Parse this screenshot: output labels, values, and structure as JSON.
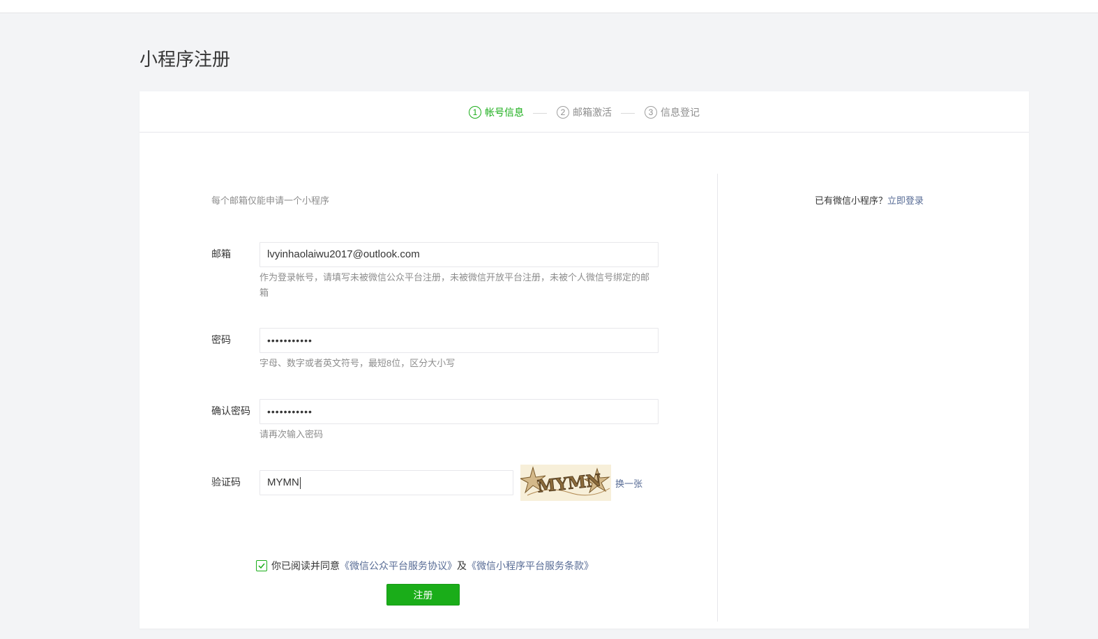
{
  "page": {
    "title": "小程序注册"
  },
  "steps": [
    {
      "num": "1",
      "label": "帐号信息",
      "active": true
    },
    {
      "num": "2",
      "label": "邮箱激活",
      "active": false
    },
    {
      "num": "3",
      "label": "信息登记",
      "active": false
    }
  ],
  "form": {
    "tip": "每个邮箱仅能申请一个小程序",
    "email": {
      "label": "邮箱",
      "value": "lvyinhaolaiwu2017@outlook.com",
      "hint": "作为登录帐号，请填写未被微信公众平台注册，未被微信开放平台注册，未被个人微信号绑定的邮箱"
    },
    "password": {
      "label": "密码",
      "value": "•••••••••••",
      "hint": "字母、数字或者英文符号，最短8位，区分大小写"
    },
    "confirm_password": {
      "label": "确认密码",
      "value": "•••••••••••",
      "hint": "请再次输入密码"
    },
    "captcha": {
      "label": "验证码",
      "value": "MYMN",
      "image_text": "MYMN",
      "swap_label": "换一张"
    },
    "agreement": {
      "checked": true,
      "prefix": "你已阅读并同意",
      "link1": "《微信公众平台服务协议》",
      "conj": "及",
      "link2": "《微信小程序平台服务条款》"
    },
    "submit_label": "注册"
  },
  "side": {
    "text": "已有微信小程序？",
    "login_link": "立即登录"
  },
  "colors": {
    "accent": "#1aad19",
    "link": "#576b95",
    "hint": "#8d8d8d"
  }
}
